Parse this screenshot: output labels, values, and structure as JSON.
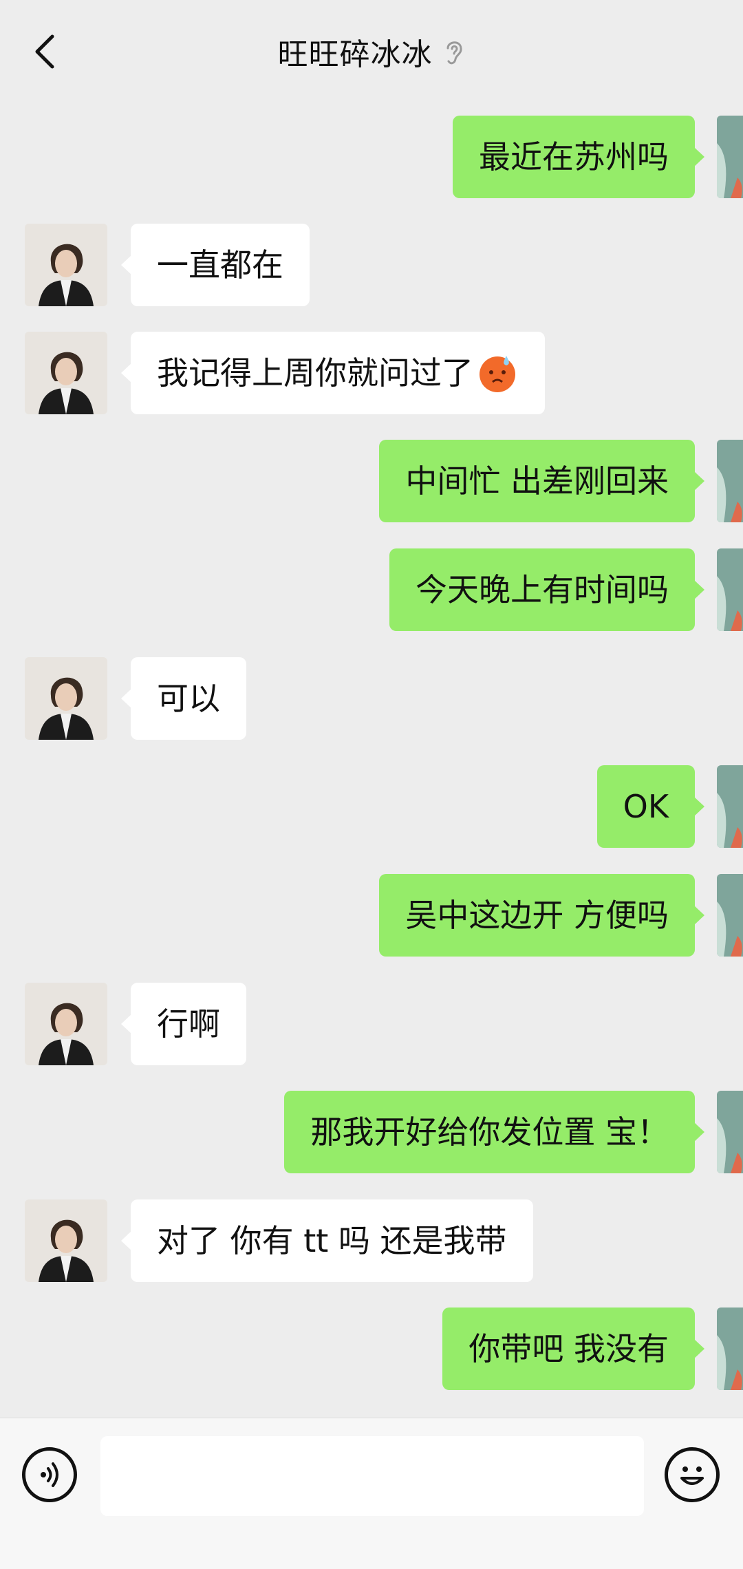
{
  "header": {
    "title": "旺旺碎冰冰",
    "ear_icon": "ear-icon",
    "back_icon": "chevron-left-icon"
  },
  "messages": [
    {
      "side": "out",
      "text": "最近在苏州吗"
    },
    {
      "side": "in",
      "text": "一直都在"
    },
    {
      "side": "in",
      "text": "我记得上周你就问过了",
      "emoji": "sweat-emoji"
    },
    {
      "side": "out",
      "text": "中间忙 出差刚回来"
    },
    {
      "side": "out",
      "text": "今天晚上有时间吗"
    },
    {
      "side": "in",
      "text": "可以"
    },
    {
      "side": "out",
      "text": "OK"
    },
    {
      "side": "out",
      "text": "吴中这边开 方便吗"
    },
    {
      "side": "in",
      "text": "行啊"
    },
    {
      "side": "out",
      "text": "那我开好给你发位置 宝！"
    },
    {
      "side": "in",
      "text": "对了 你有 tt 吗 还是我带"
    },
    {
      "side": "out",
      "text": "你带吧 我没有"
    }
  ],
  "input": {
    "value": "",
    "placeholder": ""
  },
  "colors": {
    "background": "#ededed",
    "outgoing_bubble": "#95ec69",
    "incoming_bubble": "#ffffff"
  }
}
